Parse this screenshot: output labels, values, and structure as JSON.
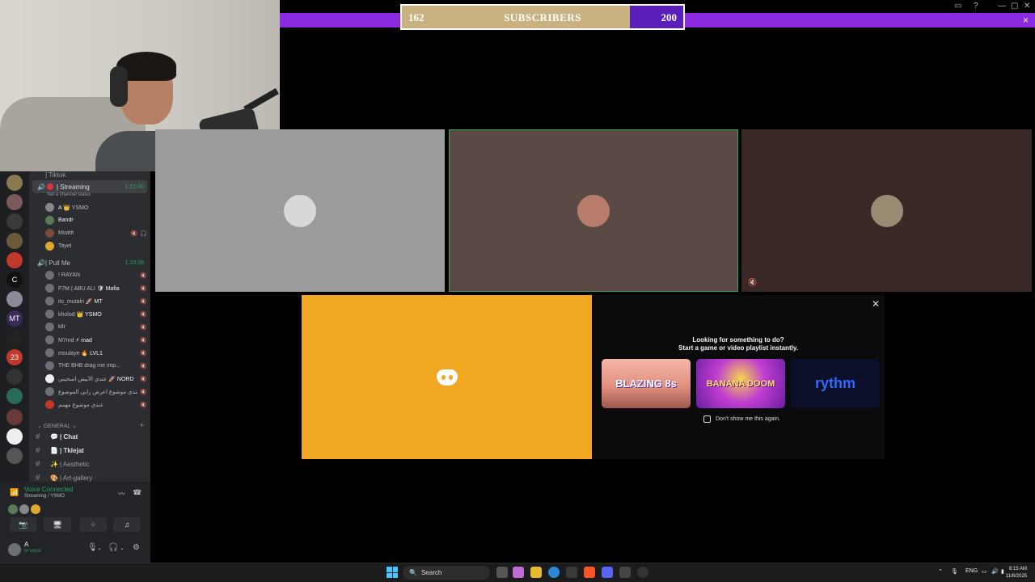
{
  "subscriber_goal": {
    "current": "162",
    "label": "SUBSCRIBERS",
    "goal": "200",
    "progress": 0.81
  },
  "window": {
    "close": "×"
  },
  "server_rail": {
    "icon_letter_c": "C",
    "icon_badge": "MT",
    "icon_notif": "23"
  },
  "sidebar": {
    "top_channel": "| Tiktok",
    "streaming_channel": {
      "name": "| Streaming",
      "timer": "1:21:00",
      "status_hint": "Set a channel status"
    },
    "streaming_members": [
      {
        "name": "A",
        "tag": "👑 YSMO"
      },
      {
        "name": "Bandr",
        "tag": ""
      },
      {
        "name": "Moath",
        "tag": ""
      },
      {
        "name": "Tayel",
        "tag": ""
      }
    ],
    "pullme_channel": {
      "name": "| Pull Me",
      "timer": "1:20:39"
    },
    "pullme_members": [
      {
        "name": "! RAYAN",
        "tag": ""
      },
      {
        "name": "F7M | ABU ALI",
        "tag": "🛡 Mafia"
      },
      {
        "name": "its_mutalri",
        "tag": "🚀 MT"
      },
      {
        "name": "kholod",
        "tag": "👑 YSMO"
      },
      {
        "name": "kllr",
        "tag": ""
      },
      {
        "name": "M7md",
        "tag": "⚡ mad"
      },
      {
        "name": "moulaye",
        "tag": "🔥 LVL1"
      },
      {
        "name": "THE BHB",
        "tag": "drag me imp..."
      },
      {
        "name": "عندي الأبيض اسحبني",
        "tag": "🚀 NORD"
      },
      {
        "name": "عندي موضوع اعرض رايي الموضوع",
        "tag": ""
      },
      {
        "name": "عندي موضوع مهمم",
        "tag": ""
      }
    ],
    "category": "GENERAL",
    "text_channels": [
      {
        "emoji": "💬",
        "name": "| Chat"
      },
      {
        "emoji": "📄",
        "name": "| Tklejat"
      },
      {
        "emoji": "✨",
        "name": "| Aesthetic"
      },
      {
        "emoji": "🎨",
        "name": "| Art-gallery"
      }
    ]
  },
  "voice_panel": {
    "status": "Voice Connected",
    "location": "Streaming / YSMO"
  },
  "user_panel": {
    "name": "A",
    "status": "In voice"
  },
  "activity": {
    "title": "Looking for something to do?",
    "subtitle": "Start a game or video playlist instantly.",
    "cards": [
      "BLAZING 8s",
      "BANANA DOOM",
      "rythm"
    ],
    "dont_show": "Don't show me this again."
  },
  "taskbar": {
    "search": "Search",
    "lang": "ENG",
    "time": "8:15 AM",
    "date": "11/8/2025"
  },
  "colors": {
    "accent_purple": "#8a2be2",
    "goal_fill": "#c9b27f",
    "discord_yellow": "#f2a722",
    "voice_green": "#23a55a"
  }
}
